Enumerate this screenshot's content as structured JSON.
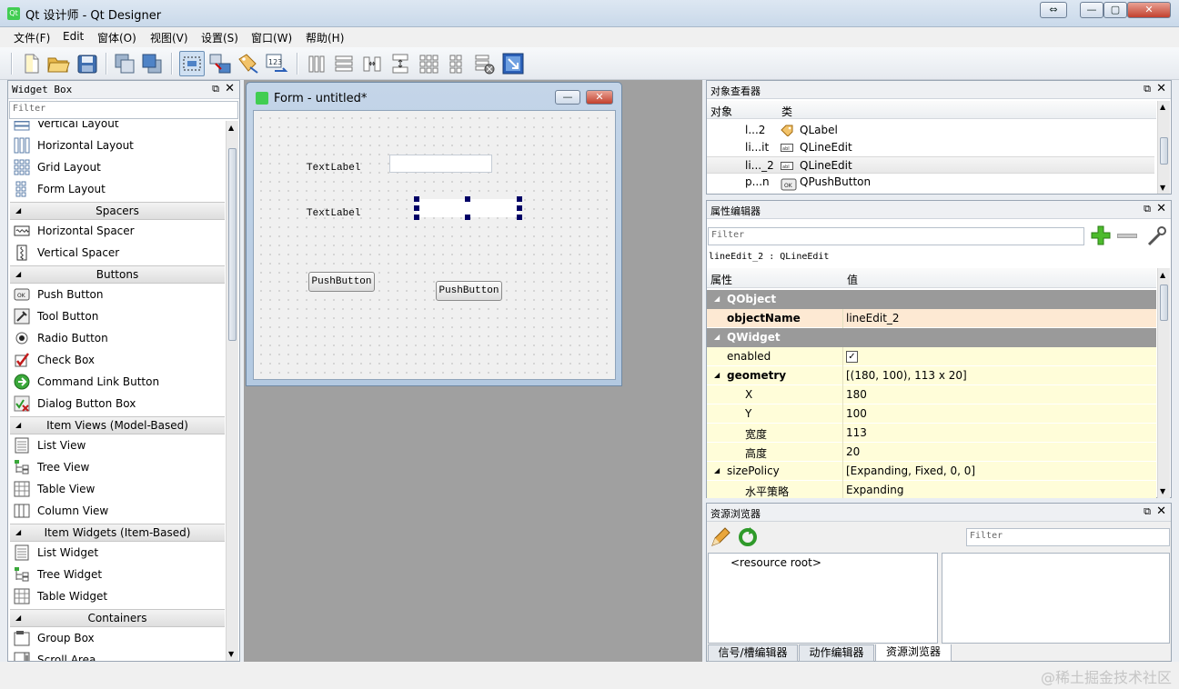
{
  "window": {
    "title": "Qt 设计师 - Qt Designer"
  },
  "menubar": [
    "文件(F)",
    "Edit",
    "窗体(O)",
    "视图(V)",
    "设置(S)",
    "窗口(W)",
    "帮助(H)"
  ],
  "widget_box": {
    "title": "Widget Box",
    "filter_placeholder": "Filter",
    "entries": [
      {
        "kind": "item",
        "label": "Vertical Layout",
        "icon": "vertical-layout-icon"
      },
      {
        "kind": "item",
        "label": "Horizontal Layout",
        "icon": "horizontal-layout-icon"
      },
      {
        "kind": "item",
        "label": "Grid Layout",
        "icon": "grid-layout-icon"
      },
      {
        "kind": "item",
        "label": "Form Layout",
        "icon": "form-layout-icon"
      },
      {
        "kind": "cat",
        "label": "Spacers"
      },
      {
        "kind": "item",
        "label": "Horizontal Spacer",
        "icon": "horizontal-spacer-icon"
      },
      {
        "kind": "item",
        "label": "Vertical Spacer",
        "icon": "vertical-spacer-icon"
      },
      {
        "kind": "cat",
        "label": "Buttons"
      },
      {
        "kind": "item",
        "label": "Push Button",
        "icon": "push-button-icon"
      },
      {
        "kind": "item",
        "label": "Tool Button",
        "icon": "tool-button-icon"
      },
      {
        "kind": "item",
        "label": "Radio Button",
        "icon": "radio-button-icon"
      },
      {
        "kind": "item",
        "label": "Check Box",
        "icon": "check-box-icon"
      },
      {
        "kind": "item",
        "label": "Command Link Button",
        "icon": "command-link-icon"
      },
      {
        "kind": "item",
        "label": "Dialog Button Box",
        "icon": "dialog-button-box-icon"
      },
      {
        "kind": "cat",
        "label": "Item Views (Model-Based)"
      },
      {
        "kind": "item",
        "label": "List View",
        "icon": "list-view-icon"
      },
      {
        "kind": "item",
        "label": "Tree View",
        "icon": "tree-view-icon"
      },
      {
        "kind": "item",
        "label": "Table View",
        "icon": "table-view-icon"
      },
      {
        "kind": "item",
        "label": "Column View",
        "icon": "column-view-icon"
      },
      {
        "kind": "cat",
        "label": "Item Widgets (Item-Based)"
      },
      {
        "kind": "item",
        "label": "List Widget",
        "icon": "list-widget-icon"
      },
      {
        "kind": "item",
        "label": "Tree Widget",
        "icon": "tree-widget-icon"
      },
      {
        "kind": "item",
        "label": "Table Widget",
        "icon": "table-widget-icon"
      },
      {
        "kind": "cat",
        "label": "Containers"
      },
      {
        "kind": "item",
        "label": "Group Box",
        "icon": "group-box-icon"
      },
      {
        "kind": "item",
        "label": "Scroll Area",
        "icon": "scroll-area-icon"
      }
    ]
  },
  "form": {
    "title": "Form - untitled*",
    "label1": "TextLabel",
    "label2": "TextLabel",
    "button1": "PushButton",
    "button2": "PushButton"
  },
  "object_inspector": {
    "title": "对象查看器",
    "col_object": "对象",
    "col_class": "类",
    "rows": [
      {
        "object": "l...2",
        "class": "QLabel",
        "icon": "label-icon"
      },
      {
        "object": "li...it",
        "class": "QLineEdit",
        "icon": "line-edit-icon"
      },
      {
        "object": "li..._2",
        "class": "QLineEdit",
        "icon": "line-edit-icon"
      },
      {
        "object": "p...n",
        "class": "QPushButton",
        "icon": "push-button-icon"
      }
    ]
  },
  "property_editor": {
    "title": "属性编辑器",
    "filter_placeholder": "Filter",
    "selected": "lineEdit_2 : QLineEdit",
    "col_property": "属性",
    "col_value": "值",
    "rows": [
      {
        "kind": "group",
        "name": "QObject"
      },
      {
        "kind": "prop",
        "name": "objectName",
        "value": "lineEdit_2",
        "bold": true,
        "indent": 0
      },
      {
        "kind": "group",
        "name": "QWidget"
      },
      {
        "kind": "prop",
        "name": "enabled",
        "value": "",
        "check": true,
        "indent": 0
      },
      {
        "kind": "prop",
        "name": "geometry",
        "value": "[(180, 100), 113 x 20]",
        "bold": true,
        "expand": true,
        "indent": 0
      },
      {
        "kind": "prop",
        "name": "X",
        "value": "180",
        "indent": 1
      },
      {
        "kind": "prop",
        "name": "Y",
        "value": "100",
        "indent": 1
      },
      {
        "kind": "prop",
        "name": "宽度",
        "value": "113",
        "indent": 1
      },
      {
        "kind": "prop",
        "name": "高度",
        "value": "20",
        "indent": 1
      },
      {
        "kind": "prop",
        "name": "sizePolicy",
        "value": "[Expanding, Fixed, 0, 0]",
        "expand": true,
        "indent": 0
      },
      {
        "kind": "prop",
        "name": "水平策略",
        "value": "Expanding",
        "indent": 1
      }
    ]
  },
  "resource_browser": {
    "title": "资源浏览器",
    "filter_placeholder": "Filter",
    "root": "<resource root>"
  },
  "bottom_tabs": [
    "信号/槽编辑器",
    "动作编辑器",
    "资源浏览器"
  ],
  "watermark": "@稀土掘金技术社区",
  "colors": {
    "selection_handle": "#000066",
    "group_row": "#9a9a9a",
    "prop_row": "#fffdd9"
  }
}
